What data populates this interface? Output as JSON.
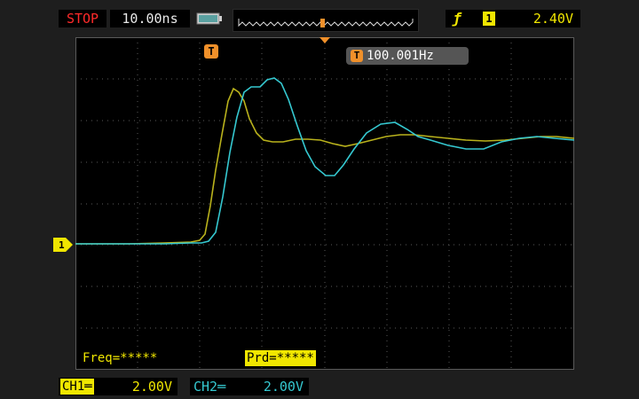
{
  "header": {
    "run_state": "STOP",
    "timebase": "10.00ns",
    "trigger": {
      "edge_icon": "rising-edge-icon",
      "source": "1",
      "level": "2.40V"
    }
  },
  "screen": {
    "trigger_marker": "T",
    "freq_badge": {
      "icon": "T",
      "value": "100.001Hz"
    },
    "ch1_ground_marker": "1",
    "measurements": {
      "freq": "Freq=*****",
      "prd": "Prd=*****"
    }
  },
  "footer": {
    "ch1": {
      "label": "CH1",
      "scale": "2.00V",
      "coupling_icon": "dc-coupling-icon"
    },
    "ch2": {
      "label": "CH2",
      "scale": "2.00V",
      "coupling_icon": "dc-coupling-icon"
    }
  },
  "colors": {
    "ch1": "#f0e600",
    "ch2": "#35c8d0",
    "stop": "#ff2a2a",
    "trigger": "#f0902a",
    "grid": "#5a5a5a"
  }
}
